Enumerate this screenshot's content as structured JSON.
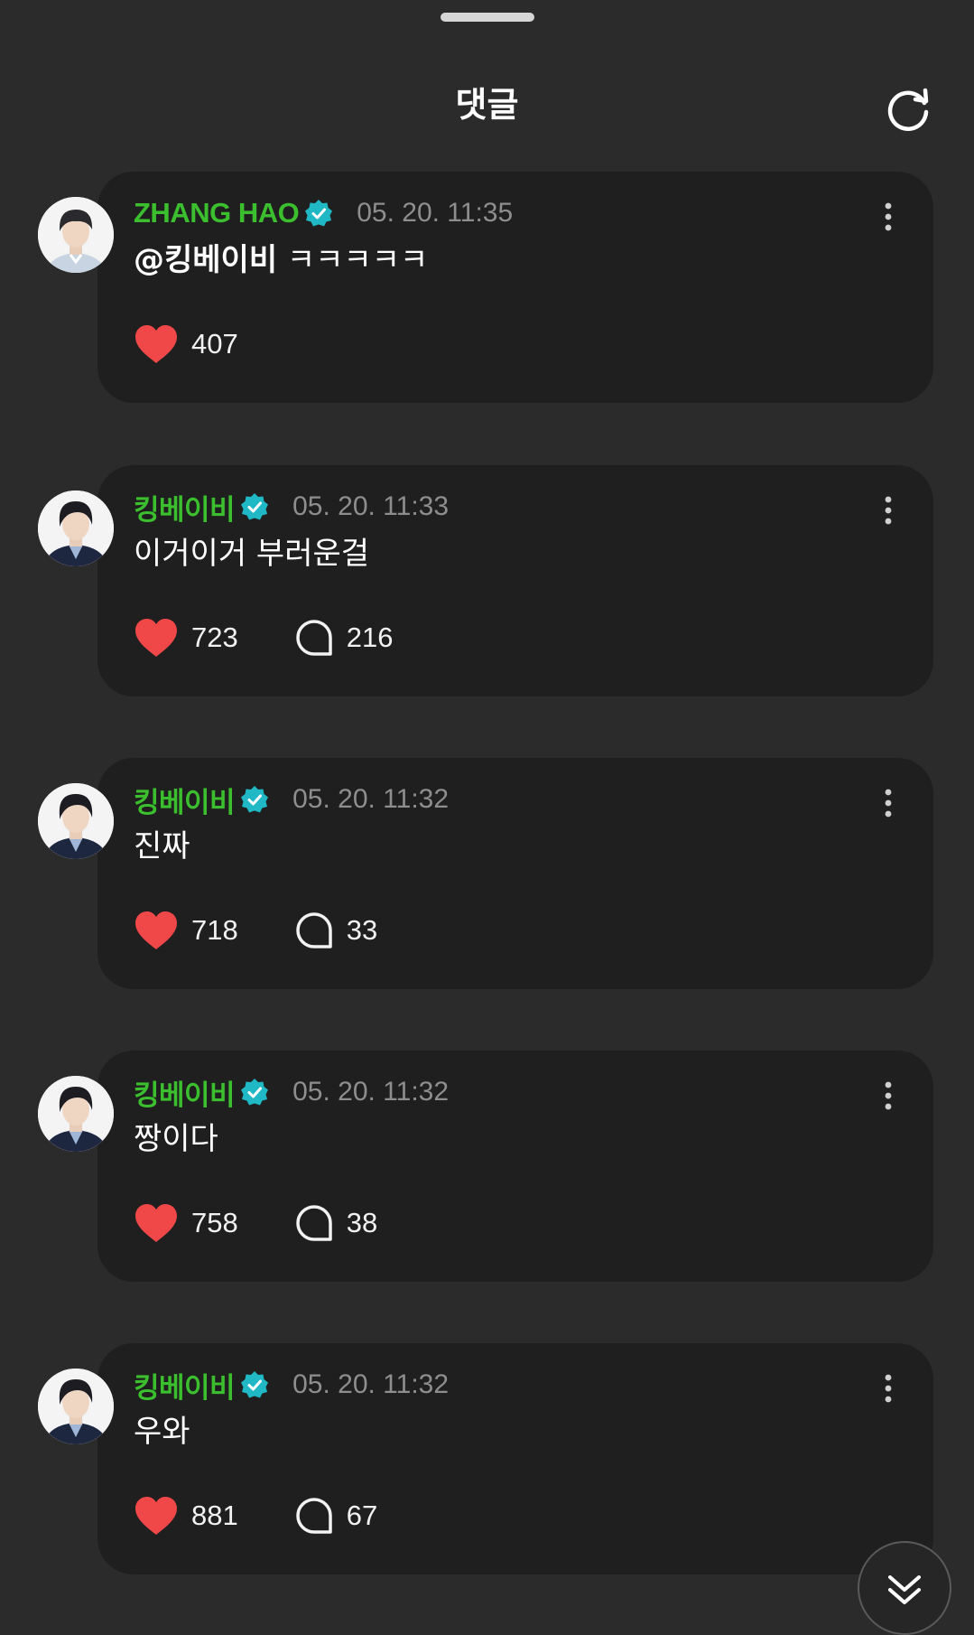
{
  "header": {
    "title": "댓글"
  },
  "comments": [
    {
      "author": "ZHANG HAO",
      "time": "05. 20. 11:35",
      "mention": "@킹베이비",
      "text": " ㅋㅋㅋㅋㅋ",
      "likes": "407",
      "replies": null
    },
    {
      "author": "킹베이비",
      "time": "05. 20. 11:33",
      "mention": "",
      "text": "이거이거 부러운걸",
      "likes": "723",
      "replies": "216"
    },
    {
      "author": "킹베이비",
      "time": "05. 20. 11:32",
      "mention": "",
      "text": "진짜",
      "likes": "718",
      "replies": "33"
    },
    {
      "author": "킹베이비",
      "time": "05. 20. 11:32",
      "mention": "",
      "text": "짱이다",
      "likes": "758",
      "replies": "38"
    },
    {
      "author": "킹베이비",
      "time": "05. 20. 11:32",
      "mention": "",
      "text": "우와",
      "likes": "881",
      "replies": "67"
    }
  ],
  "icons": {
    "refresh": "refresh-icon",
    "verified": "verified-badge-icon",
    "more": "more-vertical-icon",
    "like": "heart-icon",
    "reply": "comment-bubble-icon",
    "scroll": "double-chevron-down-icon"
  },
  "colors": {
    "background": "#2b2b2b",
    "card": "#1f1f1f",
    "author": "#3cbf2e",
    "verified": "#1fb8c4",
    "heart": "#f04848",
    "time": "#8e8e8e"
  }
}
